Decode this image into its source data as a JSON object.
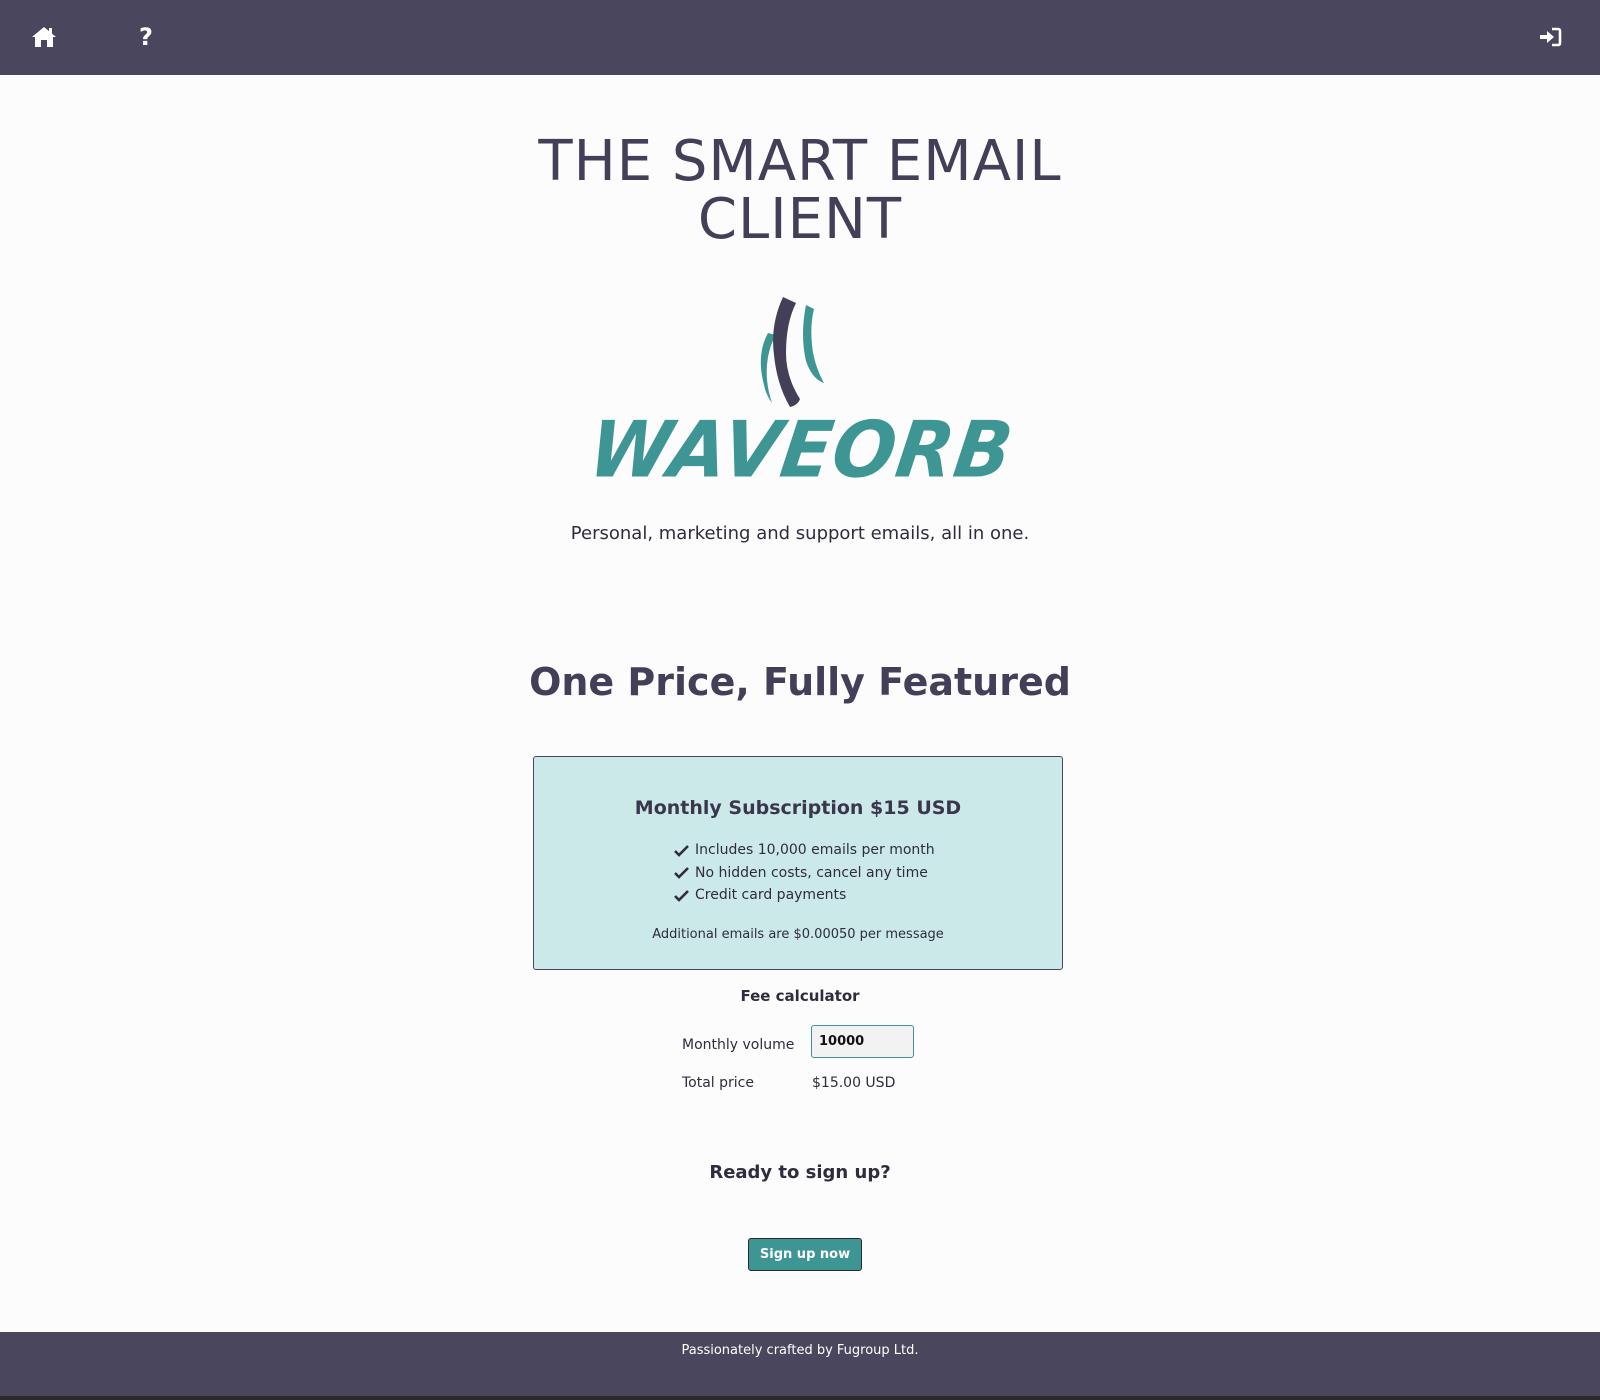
{
  "header": {
    "home_icon": "home-icon",
    "help_icon": "question-icon",
    "help_glyph": "?",
    "login_icon": "sign-in-icon"
  },
  "hero": {
    "title_line1": "THE SMART EMAIL",
    "title_line2": "CLIENT",
    "logo_text": "WAVEORB",
    "tagline": "Personal, marketing and support emails, all in one."
  },
  "pricing": {
    "heading": "One Price, Fully Featured",
    "plan_title": "Monthly Subscription $15 USD",
    "features": [
      "Includes 10,000 emails per month",
      "No hidden costs, cancel any time",
      "Credit card payments"
    ],
    "note": "Additional emails are $0.00050 per message"
  },
  "calculator": {
    "heading": "Fee calculator",
    "volume_label": "Monthly volume",
    "volume_value": "10000",
    "total_label": "Total price",
    "total_value": "$15.00 USD"
  },
  "signup": {
    "heading": "Ready to sign up?",
    "button_label": "Sign up now"
  },
  "footer": {
    "text": "Passionately crafted by Fugroup Ltd."
  },
  "colors": {
    "nav_bg": "#4a465e",
    "accent": "#3e9694",
    "card_bg": "#cce9ea",
    "heading": "#443f58"
  }
}
